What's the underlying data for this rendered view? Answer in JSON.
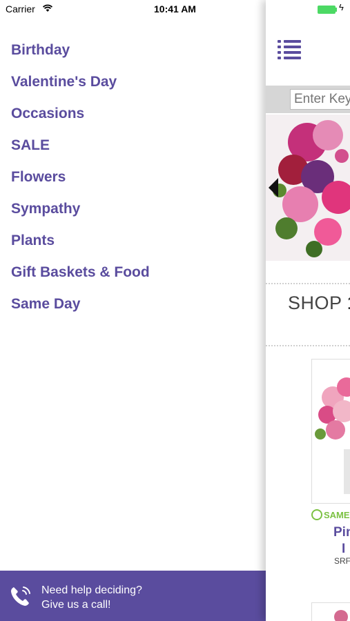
{
  "status_bar": {
    "carrier": "Carrier",
    "time": "10:41 AM"
  },
  "drawer": {
    "menu_items": [
      {
        "label": "Birthday"
      },
      {
        "label": "Valentine's Day"
      },
      {
        "label": "Occasions"
      },
      {
        "label": "SALE"
      },
      {
        "label": "Flowers"
      },
      {
        "label": "Sympathy"
      },
      {
        "label": "Plants"
      },
      {
        "label": "Gift Baskets & Food"
      },
      {
        "label": "Same Day"
      }
    ],
    "help": {
      "line1": "Need help deciding?",
      "line2": "Give us a call!",
      "icon": "phone-icon"
    }
  },
  "main": {
    "search_placeholder": "Enter Keyword",
    "shop_title_light": "SHOP ",
    "shop_title_bold": "1",
    "product": {
      "badge": "SAME",
      "name_line1": "Pin",
      "name_line2": "I",
      "sku": "SRF"
    }
  },
  "colors": {
    "brand_purple": "#5a4c9e",
    "same_day_green": "#7bc142",
    "battery_green": "#4cd964"
  }
}
